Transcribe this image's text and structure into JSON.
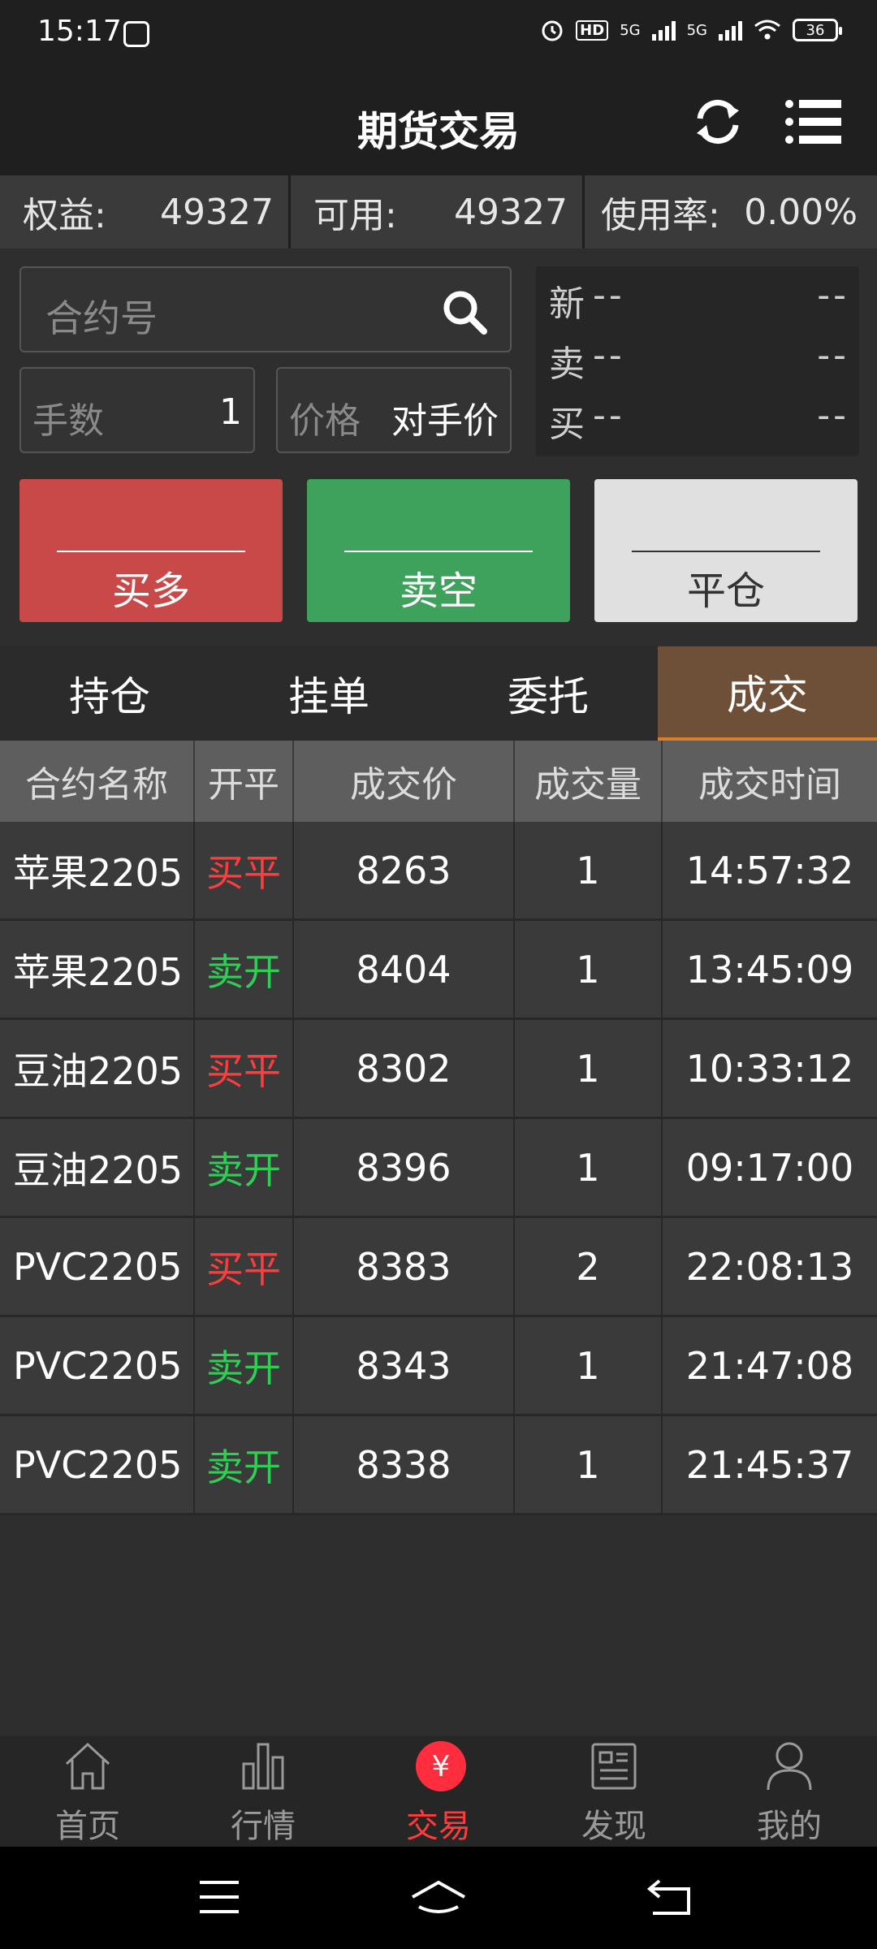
{
  "status_bar": {
    "time": "15:17",
    "network1": "5G",
    "network2": "5G",
    "battery": "36",
    "hd_label": "HD"
  },
  "header": {
    "title": "期货交易"
  },
  "account": {
    "equity_label": "权益:",
    "equity_value": "49327",
    "available_label": "可用:",
    "available_value": "49327",
    "usage_label": "使用率:",
    "usage_value": "0.00%"
  },
  "form": {
    "contract_placeholder": "合约号",
    "qty_label": "手数",
    "qty_value": "1",
    "price_label": "价格",
    "price_value": "对手价"
  },
  "quote": [
    {
      "label": "新",
      "a": "--",
      "b": "--"
    },
    {
      "label": "卖",
      "a": "--",
      "b": "--"
    },
    {
      "label": "买",
      "a": "--",
      "b": "--"
    }
  ],
  "actions": {
    "buy": "买多",
    "sell": "卖空",
    "close": "平仓"
  },
  "tabs": [
    {
      "label": "持仓",
      "active": false
    },
    {
      "label": "挂单",
      "active": false
    },
    {
      "label": "委托",
      "active": false
    },
    {
      "label": "成交",
      "active": true
    }
  ],
  "table": {
    "headers": [
      "合约名称",
      "开平",
      "成交价",
      "成交量",
      "成交时间"
    ],
    "rows": [
      {
        "name": "苹果2205",
        "side": "买平",
        "side_type": "buy",
        "price": "8263",
        "qty": "1",
        "time": "14:57:32"
      },
      {
        "name": "苹果2205",
        "side": "卖开",
        "side_type": "sell",
        "price": "8404",
        "qty": "1",
        "time": "13:45:09"
      },
      {
        "name": "豆油2205",
        "side": "买平",
        "side_type": "buy",
        "price": "8302",
        "qty": "1",
        "time": "10:33:12"
      },
      {
        "name": "豆油2205",
        "side": "卖开",
        "side_type": "sell",
        "price": "8396",
        "qty": "1",
        "time": "09:17:00"
      },
      {
        "name": "PVC2205",
        "side": "买平",
        "side_type": "buy",
        "price": "8383",
        "qty": "2",
        "time": "22:08:13"
      },
      {
        "name": "PVC2205",
        "side": "卖开",
        "side_type": "sell",
        "price": "8343",
        "qty": "1",
        "time": "21:47:08"
      },
      {
        "name": "PVC2205",
        "side": "卖开",
        "side_type": "sell",
        "price": "8338",
        "qty": "1",
        "time": "21:45:37"
      }
    ]
  },
  "bottom_nav": {
    "home": "首页",
    "market": "行情",
    "trade": "交易",
    "trade_symbol": "¥",
    "discover": "发现",
    "me": "我的"
  },
  "colors": {
    "buy": "#ff3d3d",
    "sell": "#2fcf55",
    "accent": "#e07b28",
    "active_nav": "#ff3b3b"
  }
}
